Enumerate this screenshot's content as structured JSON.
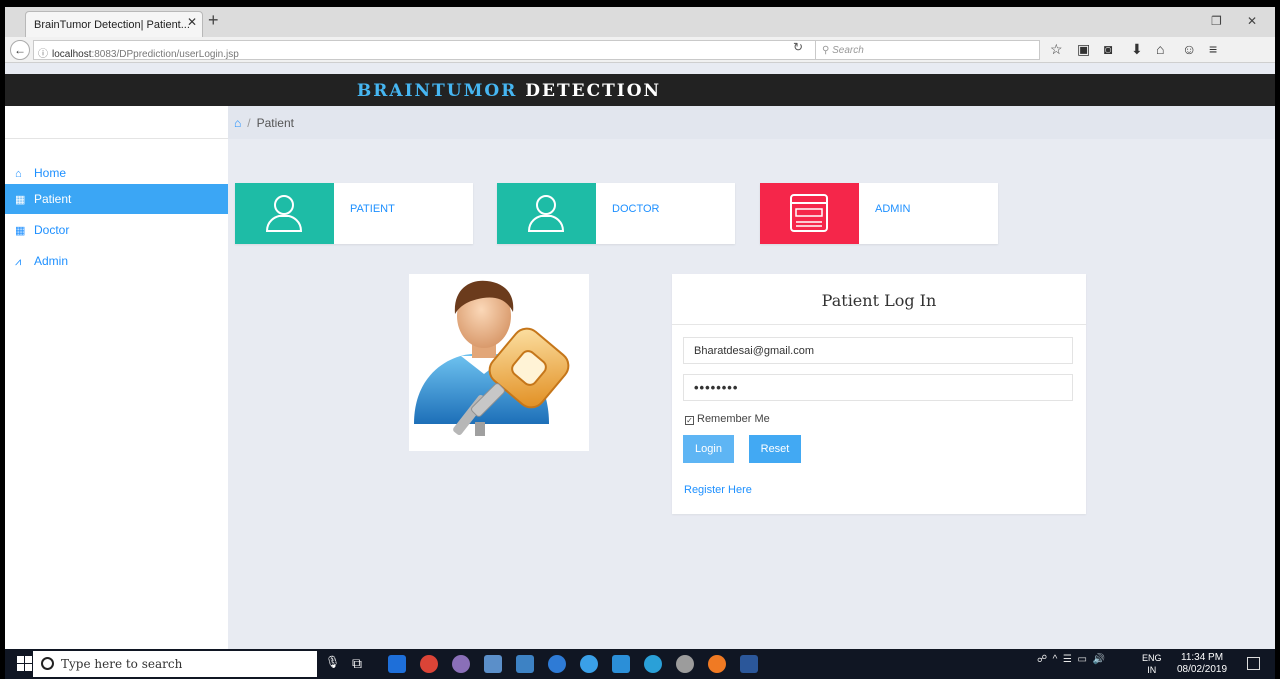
{
  "browser": {
    "tab_title": "BrainTumor Detection| Patient...",
    "url_host": "localhost",
    "url_rest": ":8083/DPprediction/userLogin.jsp",
    "search_placeholder": "Search"
  },
  "app": {
    "brand_part1": "BRAINTUMOR",
    "brand_part2": "DETECTION"
  },
  "breadcrumb": {
    "current": "Patient"
  },
  "sidebar": {
    "items": [
      {
        "label": "Home",
        "icon": "home-icon",
        "active": false
      },
      {
        "label": "Patient",
        "icon": "calendar-icon",
        "active": true
      },
      {
        "label": "Doctor",
        "icon": "calendar-icon",
        "active": false
      },
      {
        "label": "Admin",
        "icon": "chart-icon",
        "active": false
      }
    ]
  },
  "cards": [
    {
      "label": "PATIENT",
      "icon": "user-icon",
      "color": "#1ebca6"
    },
    {
      "label": "DOCTOR",
      "icon": "user-icon",
      "color": "#1ebca6"
    },
    {
      "label": "ADMIN",
      "icon": "window-icon",
      "color": "#f5264a"
    }
  ],
  "login": {
    "title": "Patient Log In",
    "email_value": "Bharatdesai@gmail.com",
    "password_value": "••••••••",
    "remember_label": "Remember Me",
    "remember_checked": true,
    "login_label": "Login",
    "reset_label": "Reset",
    "register_label": "Register Here"
  },
  "taskbar": {
    "search_placeholder": "Type here to search",
    "lang_line1": "ENG",
    "lang_line2": "IN",
    "time": "11:34 PM",
    "date": "08/02/2019"
  },
  "colors": {
    "accent": "#3ba6f5",
    "teal": "#1ebca6",
    "red": "#f5264a",
    "header_bg": "#222222"
  }
}
